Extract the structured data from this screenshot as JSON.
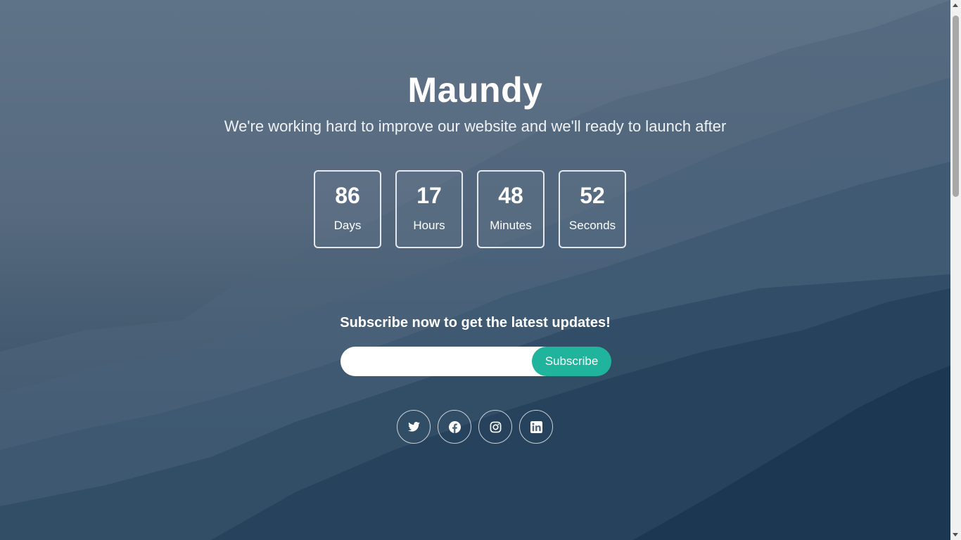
{
  "hero": {
    "title": "Maundy",
    "tagline": "We're working hard to improve our website and we'll ready to launch after"
  },
  "countdown": [
    {
      "value": "86",
      "label": "Days"
    },
    {
      "value": "17",
      "label": "Hours"
    },
    {
      "value": "48",
      "label": "Minutes"
    },
    {
      "value": "52",
      "label": "Seconds"
    }
  ],
  "subscribe": {
    "heading": "Subscribe now to get the latest updates!",
    "email_value": "",
    "email_placeholder": "",
    "button_label": "Subscribe"
  },
  "social": [
    {
      "icon": "twitter-icon"
    },
    {
      "icon": "facebook-icon"
    },
    {
      "icon": "instagram-icon"
    },
    {
      "icon": "linkedin-icon"
    }
  ],
  "colors": {
    "accent": "#1fb49b",
    "text": "#ffffff",
    "sky": "#5f7388",
    "mountain_dark": "#243a50"
  }
}
